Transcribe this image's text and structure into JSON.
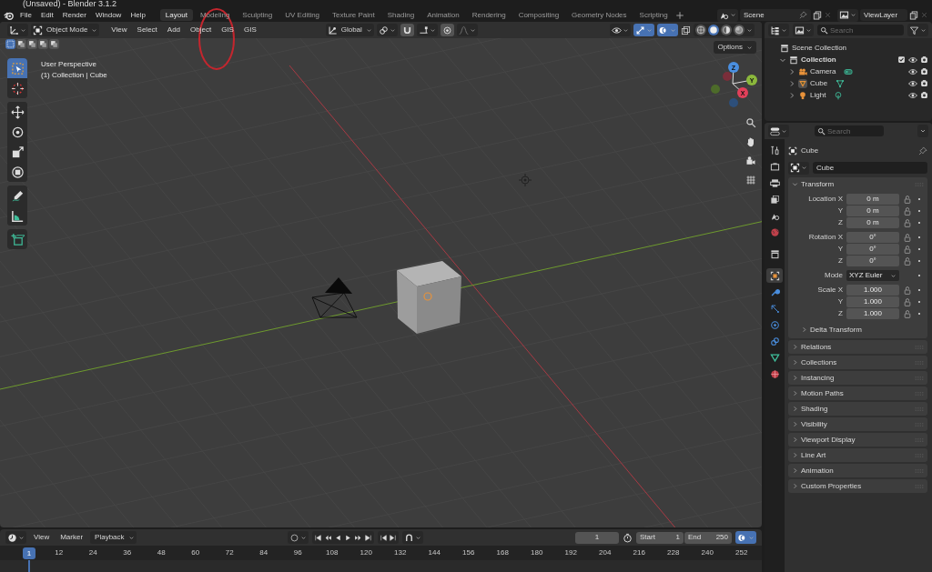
{
  "window": {
    "title": "(Unsaved) - Blender 3.1.2"
  },
  "menu": [
    "File",
    "Edit",
    "Render",
    "Window",
    "Help"
  ],
  "workspaces": [
    {
      "label": "Layout",
      "selected": true
    },
    {
      "label": "Modeling",
      "selected": false
    },
    {
      "label": "Sculpting",
      "selected": false
    },
    {
      "label": "UV Editing",
      "selected": false
    },
    {
      "label": "Texture Paint",
      "selected": false
    },
    {
      "label": "Shading",
      "selected": false
    },
    {
      "label": "Animation",
      "selected": false
    },
    {
      "label": "Rendering",
      "selected": false
    },
    {
      "label": "Compositing",
      "selected": false
    },
    {
      "label": "Geometry Nodes",
      "selected": false
    },
    {
      "label": "Scripting",
      "selected": false
    }
  ],
  "scene": {
    "value": "Scene"
  },
  "view_layer": {
    "value": "ViewLayer"
  },
  "viewport_header": {
    "mode": "Object Mode",
    "menus": [
      "View",
      "Select",
      "Add",
      "Object",
      "GIS",
      "GIS"
    ],
    "orientation": "Global",
    "shading": [
      {
        "selected": false
      },
      {
        "selected": true
      },
      {
        "selected": false
      },
      {
        "selected": false
      }
    ],
    "options": "Options"
  },
  "select_modes": [
    {
      "selected": true
    },
    {
      "selected": false
    },
    {
      "selected": false
    },
    {
      "selected": false
    },
    {
      "selected": false
    }
  ],
  "viewport": {
    "view_name": "User Perspective",
    "context": "(1) Collection | Cube",
    "gizmo_axes": [
      "X",
      "Y",
      "Z"
    ]
  },
  "tools": [
    {
      "selected": true
    },
    {
      "selected": false
    },
    {
      "selected": false
    },
    {
      "selected": false
    },
    {
      "selected": false
    },
    {
      "selected": false
    },
    {
      "selected": false
    },
    {
      "selected": false
    },
    {
      "selected": false
    }
  ],
  "outliner": {
    "search_placeholder": "Search",
    "tree": [
      {
        "label": "Scene Collection",
        "children": [
          {
            "label": "Collection",
            "expanded": true,
            "checked": true,
            "children": [
              {
                "label": "Camera",
                "kind": "camera",
                "expanded": false,
                "active": false
              },
              {
                "label": "Cube",
                "kind": "mesh",
                "expanded": false,
                "active": true
              },
              {
                "label": "Light",
                "kind": "light",
                "expanded": false,
                "active": false
              }
            ]
          }
        ]
      }
    ]
  },
  "properties": {
    "search_placeholder": "Search",
    "tabs": [
      {
        "selected": false
      },
      {
        "selected": false
      },
      {
        "selected": false
      },
      {
        "selected": false
      },
      {
        "selected": false
      },
      {
        "selected": false
      },
      {
        "selected": false
      },
      {
        "selected": true
      },
      {
        "selected": false
      },
      {
        "selected": false
      },
      {
        "selected": false
      },
      {
        "selected": false
      },
      {
        "selected": false
      },
      {
        "selected": false
      }
    ],
    "object_name": "Cube",
    "data_name": "Cube",
    "transform": {
      "title": "Transform",
      "expanded": true,
      "groups": [
        [
          {
            "label": "Location X",
            "value": "0 m",
            "kind": "number"
          },
          {
            "label": "Y",
            "value": "0 m",
            "kind": "number"
          },
          {
            "label": "Z",
            "value": "0 m",
            "kind": "number"
          }
        ],
        [
          {
            "label": "Rotation X",
            "value": "0°",
            "kind": "number"
          },
          {
            "label": "Y",
            "value": "0°",
            "kind": "number"
          },
          {
            "label": "Z",
            "value": "0°",
            "kind": "number"
          }
        ],
        [
          {
            "label": "Mode",
            "value": "XYZ Euler",
            "kind": "dropdown"
          }
        ],
        [
          {
            "label": "Scale X",
            "value": "1.000",
            "kind": "number"
          },
          {
            "label": "Y",
            "value": "1.000",
            "kind": "number"
          },
          {
            "label": "Z",
            "value": "1.000",
            "kind": "number"
          }
        ]
      ],
      "subpanel": {
        "title": "Delta Transform",
        "expanded": false
      }
    },
    "panels": [
      {
        "title": "Relations",
        "expanded": false
      },
      {
        "title": "Collections",
        "expanded": false
      },
      {
        "title": "Instancing",
        "expanded": false
      },
      {
        "title": "Motion Paths",
        "expanded": false
      },
      {
        "title": "Shading",
        "expanded": false
      },
      {
        "title": "Visibility",
        "expanded": false
      },
      {
        "title": "Viewport Display",
        "expanded": false
      },
      {
        "title": "Line Art",
        "expanded": false
      },
      {
        "title": "Animation",
        "expanded": false
      },
      {
        "title": "Custom Properties",
        "expanded": false
      }
    ]
  },
  "timeline": {
    "menus": [
      "View",
      "Marker",
      "Playback"
    ],
    "current_frame": "1",
    "start_label": "Start",
    "start": "1",
    "end_label": "End",
    "end": "250",
    "playhead": "1",
    "ticks": [
      "12",
      "24",
      "36",
      "48",
      "60",
      "72",
      "84",
      "96",
      "108",
      "120",
      "132",
      "144",
      "156",
      "168",
      "180",
      "192",
      "204",
      "216",
      "228",
      "240",
      "252"
    ]
  }
}
